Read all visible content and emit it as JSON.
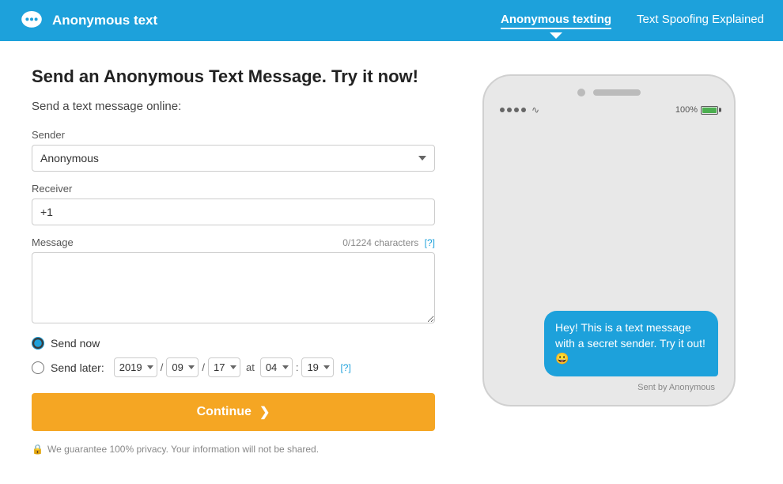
{
  "navbar": {
    "brand_name": "Anonymous text",
    "nav_links": [
      {
        "label": "Anonymous texting",
        "active": true
      },
      {
        "label": "Text Spoofing Explained",
        "active": false
      }
    ]
  },
  "page": {
    "title": "Send an Anonymous Text Message. Try it now!",
    "subtitle": "Send a text message online:",
    "sender_label": "Sender",
    "sender_value": "Anonymous",
    "receiver_label": "Receiver",
    "receiver_placeholder": "+1",
    "message_label": "Message",
    "char_count": "0/1224 characters",
    "char_help": "[?]",
    "radio_send_now": "Send now",
    "radio_send_later": "Send later:",
    "schedule_year": "2019",
    "schedule_month": "09",
    "schedule_day": "17",
    "schedule_at": "at",
    "schedule_hour": "04",
    "schedule_min": "19",
    "schedule_help": "[?]",
    "continue_label": "Continue",
    "continue_icon": "❯",
    "privacy_text": "We guarantee 100% privacy. Your information will not be shared."
  },
  "phone": {
    "battery_label": "100%",
    "message_text": "Hey! This is a text message with a secret sender. Try it out! 😀",
    "sent_by": "Sent by Anonymous"
  }
}
